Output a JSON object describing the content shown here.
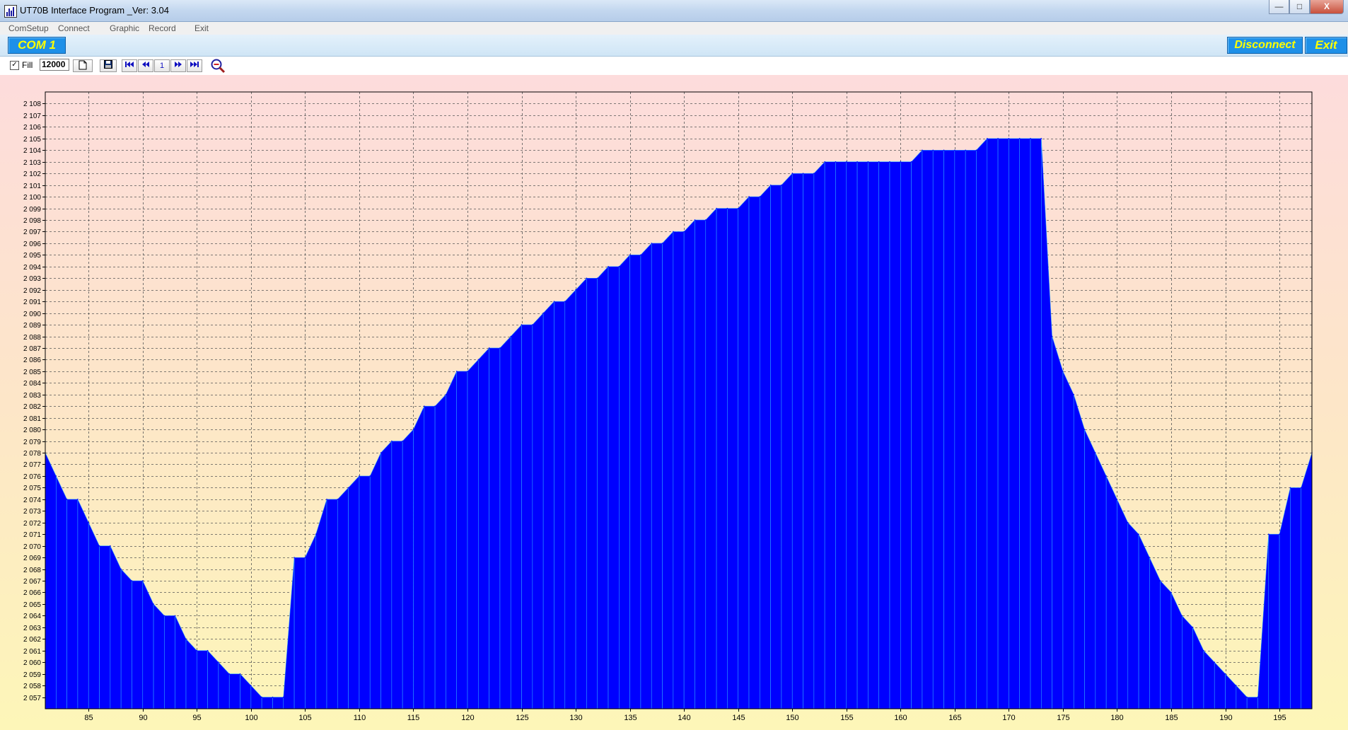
{
  "window": {
    "title": "UT70B Interface Program _Ver: 3.04",
    "minimize": "—",
    "maximize": "□",
    "close": "X"
  },
  "menu": {
    "items": [
      "ComSetup",
      "Connect",
      "Graphic",
      "Record",
      "Exit"
    ]
  },
  "combar": {
    "port_label": "COM 1",
    "disconnect_label": "Disconnect",
    "exit_label": "Exit",
    "button_color": "#1e90e8",
    "text_color": "#ffff00"
  },
  "toolbar": {
    "fill_checked": true,
    "fill_label": "Fill",
    "rate_value": "12000",
    "new_icon": "document-icon",
    "save_icon": "floppy-disk-icon",
    "first_icon": "skip-to-first-icon",
    "prev_icon": "rewind-icon",
    "page_number": "1",
    "next_icon": "fast-forward-icon",
    "last_icon": "skip-to-last-icon",
    "zoom_icon": "zoom-out-icon"
  },
  "chart_data": {
    "type": "area",
    "fill_color": "#0000ff",
    "grid": true,
    "xlim": [
      81,
      198
    ],
    "ylim": [
      2056,
      2109
    ],
    "xticks": [
      85,
      90,
      95,
      100,
      105,
      110,
      115,
      120,
      125,
      130,
      135,
      140,
      145,
      150,
      155,
      160,
      165,
      170,
      175,
      180,
      185,
      190,
      195
    ],
    "yticks": [
      2057,
      2058,
      2059,
      2060,
      2061,
      2062,
      2063,
      2064,
      2065,
      2066,
      2067,
      2068,
      2069,
      2070,
      2071,
      2072,
      2073,
      2074,
      2075,
      2076,
      2077,
      2078,
      2079,
      2080,
      2081,
      2082,
      2083,
      2084,
      2085,
      2086,
      2087,
      2088,
      2089,
      2090,
      2091,
      2092,
      2093,
      2094,
      2095,
      2096,
      2097,
      2098,
      2099,
      2100,
      2101,
      2102,
      2103,
      2104,
      2105,
      2106,
      2107,
      2108
    ],
    "ytick_labels": [
      "2 057",
      "2 058",
      "2 059",
      "2 060",
      "2 061",
      "2 062",
      "2 063",
      "2 064",
      "2 065",
      "2 066",
      "2 067",
      "2 068",
      "2 069",
      "2 070",
      "2 071",
      "2 072",
      "2 073",
      "2 074",
      "2 075",
      "2 076",
      "2 077",
      "2 078",
      "2 079",
      "2 080",
      "2 081",
      "2 082",
      "2 083",
      "2 084",
      "2 085",
      "2 086",
      "2 087",
      "2 088",
      "2 089",
      "2 090",
      "2 091",
      "2 092",
      "2 093",
      "2 094",
      "2 095",
      "2 096",
      "2 097",
      "2 098",
      "2 099",
      "2 100",
      "2 101",
      "2 102",
      "2 103",
      "2 104",
      "2 105",
      "2 106",
      "2 107",
      "2 108"
    ],
    "x": [
      81,
      82,
      83,
      84,
      85,
      86,
      87,
      88,
      89,
      90,
      91,
      92,
      93,
      94,
      95,
      96,
      97,
      98,
      99,
      100,
      101,
      102,
      103,
      104,
      105,
      106,
      107,
      108,
      109,
      110,
      111,
      112,
      113,
      114,
      115,
      116,
      117,
      118,
      119,
      120,
      121,
      122,
      123,
      124,
      125,
      126,
      127,
      128,
      129,
      130,
      131,
      132,
      133,
      134,
      135,
      136,
      137,
      138,
      139,
      140,
      141,
      142,
      143,
      144,
      145,
      146,
      147,
      148,
      149,
      150,
      151,
      152,
      153,
      154,
      155,
      156,
      157,
      158,
      159,
      160,
      161,
      162,
      163,
      164,
      165,
      166,
      167,
      168,
      169,
      170,
      171,
      172,
      173,
      174,
      175,
      176,
      177,
      178,
      179,
      180,
      181,
      182,
      183,
      184,
      185,
      186,
      187,
      188,
      189,
      190,
      191,
      192,
      193,
      194,
      195,
      196,
      197,
      198
    ],
    "y": [
      2078,
      2076,
      2074,
      2074,
      2072,
      2070,
      2070,
      2068,
      2067,
      2067,
      2065,
      2064,
      2064,
      2062,
      2061,
      2061,
      2060,
      2059,
      2059,
      2058,
      2057,
      2057,
      2057,
      2069,
      2069,
      2071,
      2074,
      2074,
      2075,
      2076,
      2076,
      2078,
      2079,
      2079,
      2080,
      2082,
      2082,
      2083,
      2085,
      2085,
      2086,
      2087,
      2087,
      2088,
      2089,
      2089,
      2090,
      2091,
      2091,
      2092,
      2093,
      2093,
      2094,
      2094,
      2095,
      2095,
      2096,
      2096,
      2097,
      2097,
      2098,
      2098,
      2099,
      2099,
      2099,
      2100,
      2100,
      2101,
      2101,
      2102,
      2102,
      2102,
      2103,
      2103,
      2103,
      2103,
      2103,
      2103,
      2103,
      2103,
      2103,
      2104,
      2104,
      2104,
      2104,
      2104,
      2104,
      2105,
      2105,
      2105,
      2105,
      2105,
      2105,
      2088,
      2085,
      2083,
      2080,
      2078,
      2076,
      2074,
      2072,
      2071,
      2069,
      2067,
      2066,
      2064,
      2063,
      2061,
      2060,
      2059,
      2058,
      2057,
      2057,
      2071,
      2071,
      2075,
      2075,
      2078
    ]
  }
}
